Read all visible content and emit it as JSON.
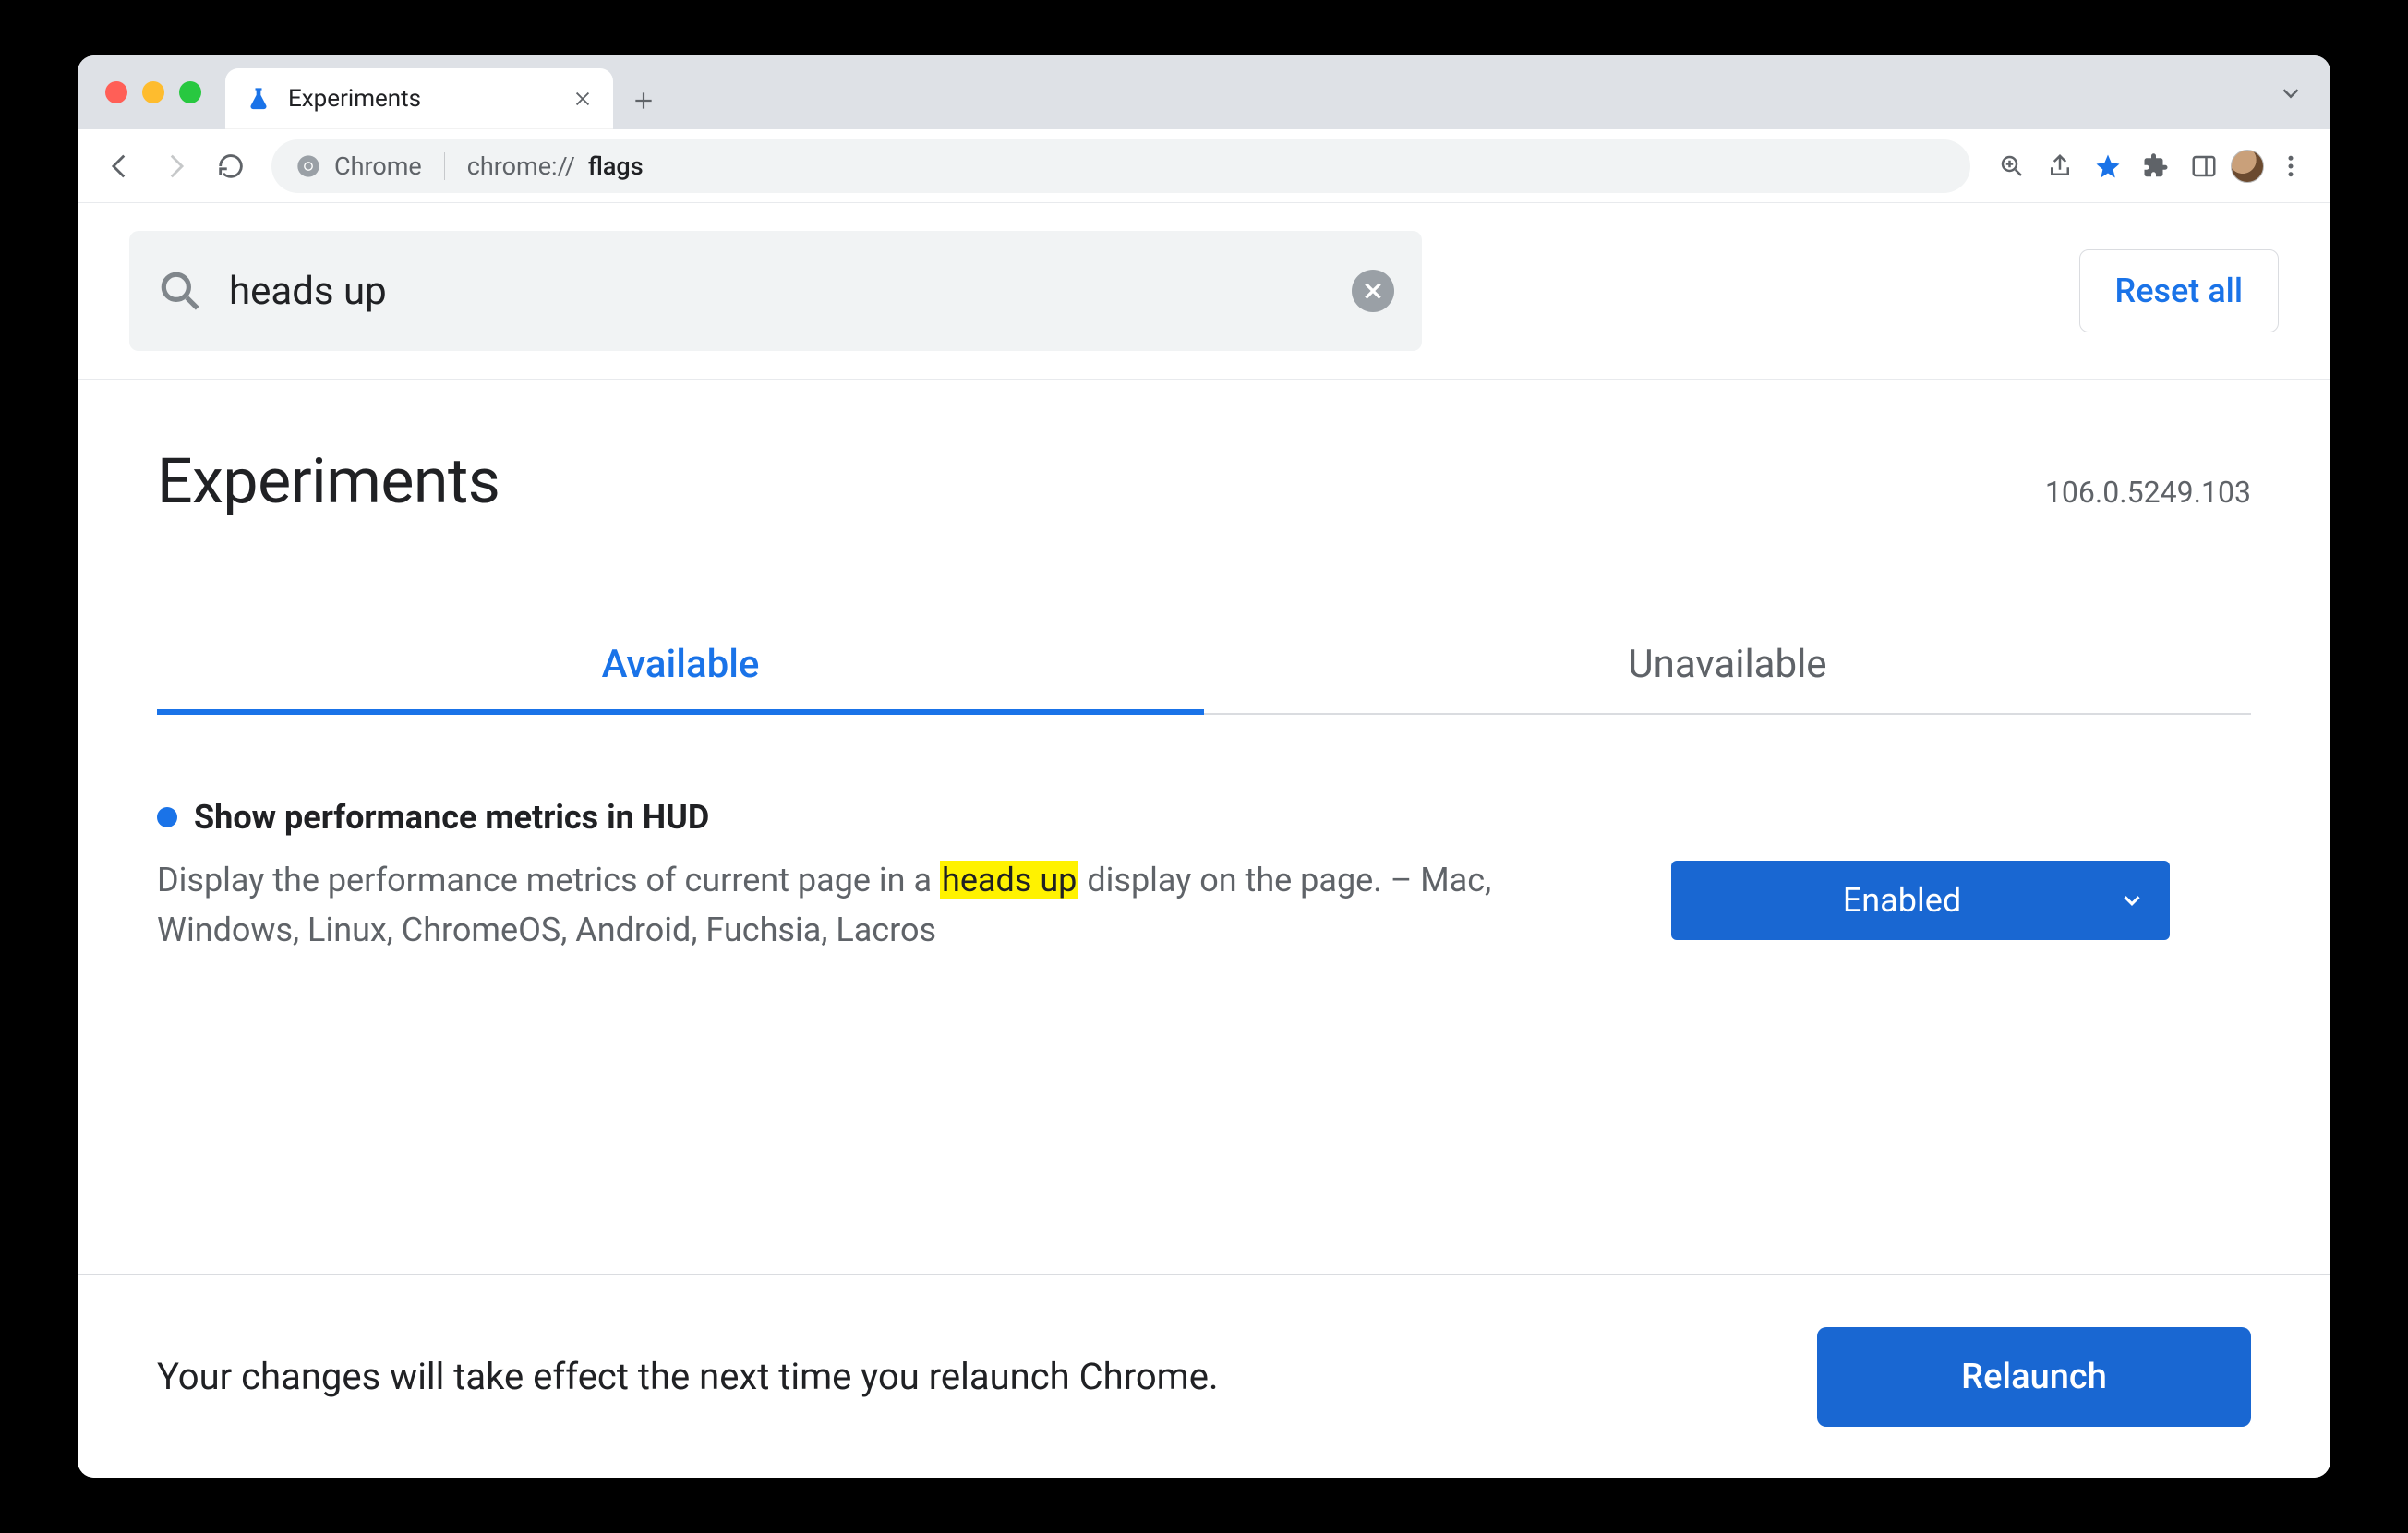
{
  "window": {
    "tab_title": "Experiments"
  },
  "omnibox": {
    "origin": "Chrome",
    "path_prefix": "chrome://",
    "path_bold": "flags"
  },
  "search": {
    "value": "heads up",
    "reset_label": "Reset all"
  },
  "page": {
    "heading": "Experiments",
    "version": "106.0.5249.103",
    "tabs": {
      "available": "Available",
      "unavailable": "Unavailable"
    }
  },
  "flag": {
    "title": "Show performance metrics in HUD",
    "desc_before": "Display the performance metrics of current page in a ",
    "desc_mark": "heads up",
    "desc_after": " display on the page. – Mac, Windows, Linux, ChromeOS, Android, Fuchsia, Lacros",
    "select_value": "Enabled"
  },
  "footer": {
    "text": "Your changes will take effect the next time you relaunch Chrome.",
    "relaunch": "Relaunch"
  }
}
